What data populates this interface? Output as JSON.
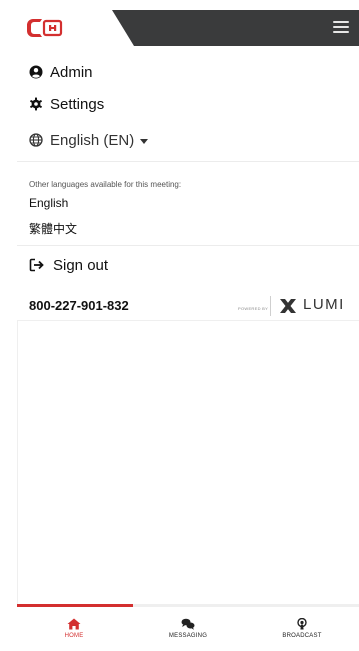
{
  "header": {
    "logo_alt": "CH logo",
    "menu_icon": "hamburger-icon"
  },
  "menu": {
    "admin_label": "Admin",
    "settings_label": "Settings",
    "language_label": "English (EN)"
  },
  "languages": {
    "note": "Other languages available for this meeting:",
    "options": [
      "English",
      "繁體中文"
    ]
  },
  "signout_label": "Sign out",
  "meeting": {
    "id": "800-227-901-832",
    "powered_by": "POWERED BY",
    "brand": "LUMI"
  },
  "tabs": [
    {
      "label": "HOME",
      "icon": "home-icon",
      "active": true
    },
    {
      "label": "MESSAGING",
      "icon": "messaging-icon",
      "active": false
    },
    {
      "label": "BROADCAST",
      "icon": "broadcast-icon",
      "active": false
    }
  ],
  "colors": {
    "accent": "#d32f2f",
    "header_dark": "#3a3b3c"
  }
}
